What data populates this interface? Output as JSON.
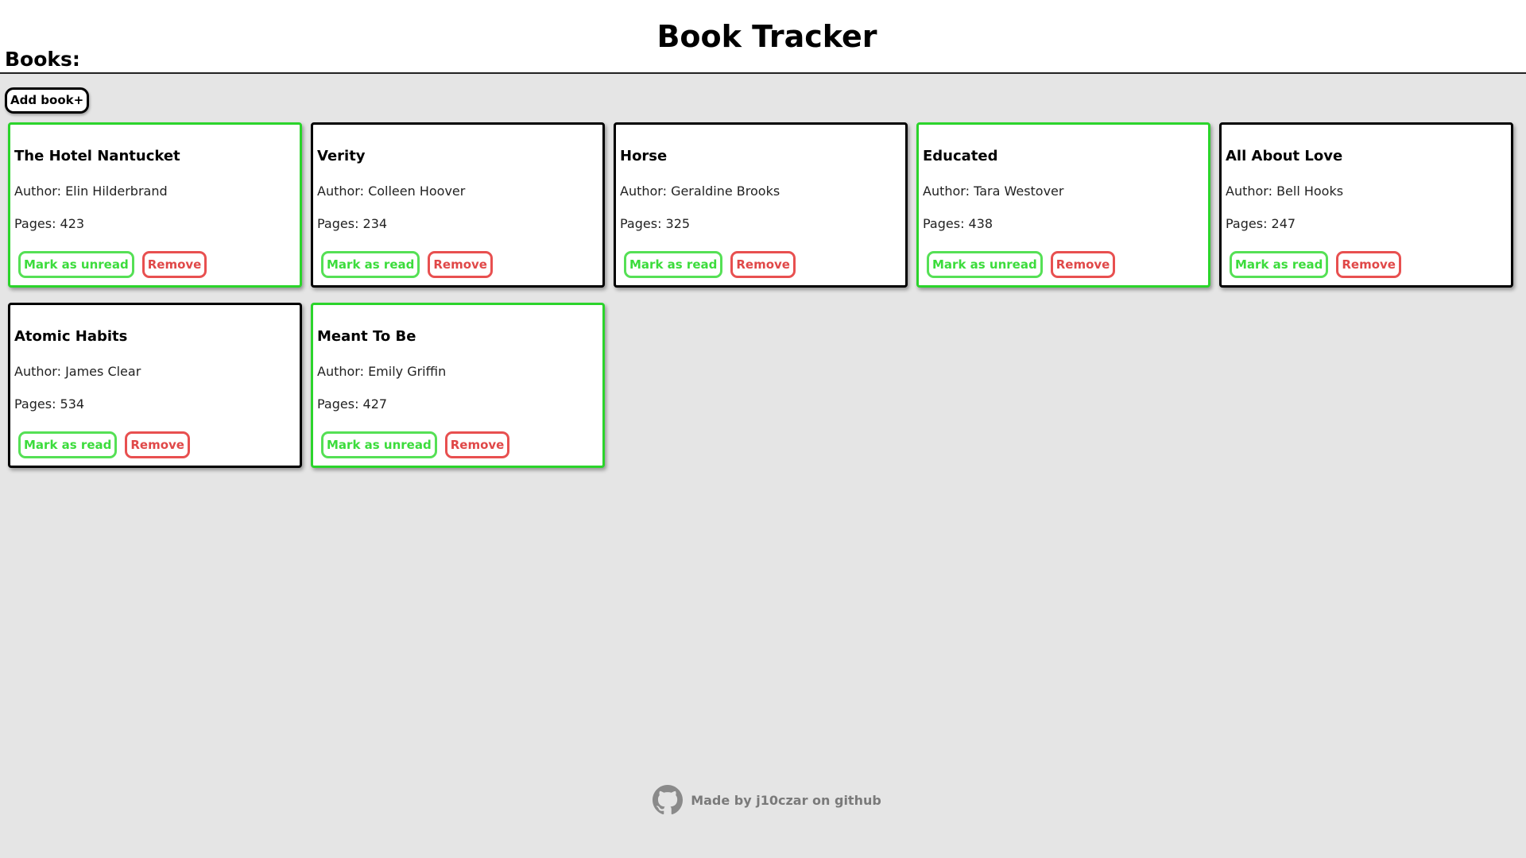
{
  "header": {
    "title": "Book Tracker"
  },
  "books_heading": "Books:",
  "add_button_label": "Add book+",
  "labels": {
    "author_prefix": "Author: ",
    "pages_prefix": "Pages: "
  },
  "books": [
    {
      "title": "The Hotel Nantucket",
      "author": "Elin Hilderbrand",
      "pages": 423,
      "read": true,
      "toggle_label": "Mark as unread",
      "remove_label": "Remove"
    },
    {
      "title": "Verity",
      "author": "Colleen Hoover",
      "pages": 234,
      "read": false,
      "toggle_label": "Mark as read",
      "remove_label": "Remove"
    },
    {
      "title": "Horse",
      "author": "Geraldine Brooks",
      "pages": 325,
      "read": false,
      "toggle_label": "Mark as read",
      "remove_label": "Remove"
    },
    {
      "title": "Educated",
      "author": "Tara Westover",
      "pages": 438,
      "read": true,
      "toggle_label": "Mark as unread",
      "remove_label": "Remove"
    },
    {
      "title": "All About Love",
      "author": "Bell Hooks",
      "pages": 247,
      "read": false,
      "toggle_label": "Mark as read",
      "remove_label": "Remove"
    },
    {
      "title": "Atomic Habits",
      "author": "James Clear",
      "pages": 534,
      "read": false,
      "toggle_label": "Mark as read",
      "remove_label": "Remove"
    },
    {
      "title": "Meant To Be",
      "author": "Emily Griffin",
      "pages": 427,
      "read": true,
      "toggle_label": "Mark as unread",
      "remove_label": "Remove"
    }
  ],
  "footer": {
    "icon": "github-icon",
    "text": "Made by j10czar on github"
  },
  "colors": {
    "read_border": "#2bd42b",
    "unread_border": "#000000",
    "toggle_button": "#3cdc3c",
    "remove_button": "#e04848",
    "background": "#e5e5e5",
    "footer_text": "#7a7a7a"
  }
}
